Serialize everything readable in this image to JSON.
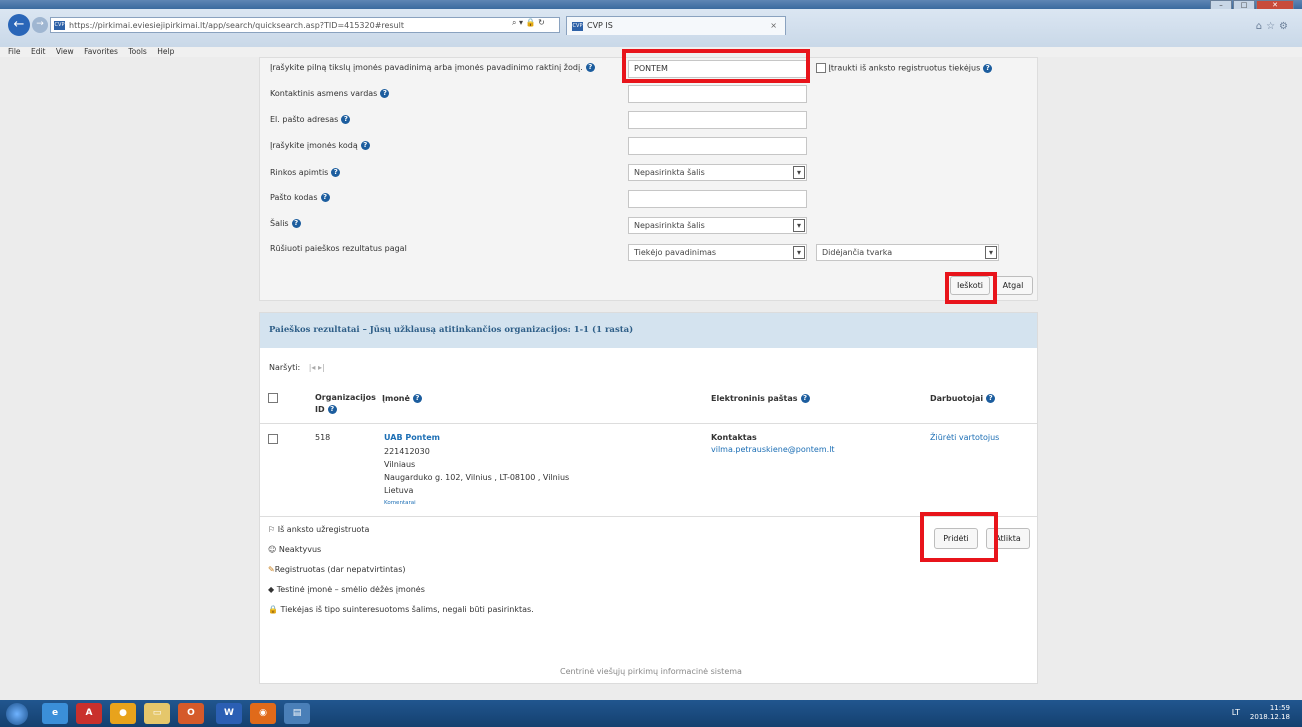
{
  "browser": {
    "url": "https://pirkimai.eviesiejipirkimai.lt/app/search/quicksearch.asp?TID=415320#result",
    "tab_title": "CVP IS",
    "favicon_text": "CVP"
  },
  "menu": [
    "File",
    "Edit",
    "View",
    "Favorites",
    "Tools",
    "Help"
  ],
  "form": {
    "company_label": "Įrašykite pilną tikslų įmonės pavadinimą arba įmonės pavadinimo raktinį žodį.",
    "company_value": "PONTEM",
    "include_registered_label": "Įtraukti iš anksto registruotus tiekėjus",
    "contact_label": "Kontaktinis asmens vardas",
    "email_label": "El. pašto adresas",
    "code_label": "Įrašykite įmonės kodą",
    "market_label": "Rinkos apimtis",
    "market_value": "Nepasirinkta šalis",
    "postal_label": "Pašto kodas",
    "country_label": "Šalis",
    "country_value": "Nepasirinkta šalis",
    "sort_label": "Rūšiuoti paieškos rezultatus pagal",
    "sort_field_value": "Tiekėjo pavadinimas",
    "sort_order_value": "Didėjančia tvarka",
    "search_button": "Ieškoti",
    "back_button": "Atgal"
  },
  "results": {
    "header": "Paieškos rezultatai – Jūsų užklausą atitinkančios organizacijos: 1-1 (1 rasta)",
    "browse_label": "Naršyti:",
    "columns": {
      "org_id": "Organizacijos ID",
      "company": "Įmonė",
      "email": "Elektroninis paštas",
      "employees": "Darbuotojai"
    },
    "row": {
      "id": "518",
      "name": "UAB Pontem",
      "code": "221412030",
      "city": "Vilniaus",
      "address": "Naugarduko g. 102, Vilnius , LT-08100 , Vilnius",
      "country": "Lietuva",
      "comment": "Komentarai",
      "contact_label": "Kontaktas",
      "email": "vilma.petrauskiene@pontem.lt",
      "view_users": "Žiūrėti vartotojus"
    },
    "legend": [
      "Iš anksto užregistruota",
      "Neaktyvus",
      "Registruotas (dar nepatvirtintas)",
      "Testinė įmonė – smėlio dėžės įmonės",
      "Tiekėjas iš tipo suinteresuotoms šalims, negali būti pasirinktas."
    ],
    "add_button": "Pridėti",
    "done_button": "Atlikta"
  },
  "footer": "Centrinė viešųjų pirkimų informacinė sistema",
  "taskbar": {
    "lang": "LT",
    "time": "11:59",
    "date": "2018.12.18"
  }
}
